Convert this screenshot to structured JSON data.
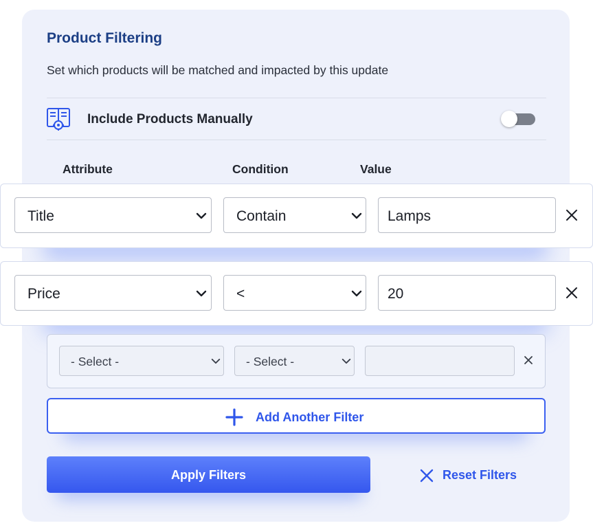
{
  "panel": {
    "title": "Product Filtering",
    "subtitle": "Set which products will be matched and impacted by this update"
  },
  "manual": {
    "label": "Include Products Manually",
    "toggle_on": false,
    "icon": "document-gear-icon"
  },
  "columns": {
    "attribute": "Attribute",
    "condition": "Condition",
    "value": "Value"
  },
  "filters": [
    {
      "attribute": "Title",
      "condition": "Contain",
      "value": "Lamps"
    },
    {
      "attribute": "Price",
      "condition": "<",
      "value": "20"
    }
  ],
  "new_filter": {
    "attribute_placeholder": "- Select -",
    "condition_placeholder": "- Select -",
    "value": ""
  },
  "buttons": {
    "add_filter": "Add Another Filter",
    "apply": "Apply Filters",
    "reset": "Reset Filters"
  },
  "colors": {
    "accent": "#3a5ff0",
    "title": "#1c3f85",
    "card_background": "#eef1fb"
  }
}
